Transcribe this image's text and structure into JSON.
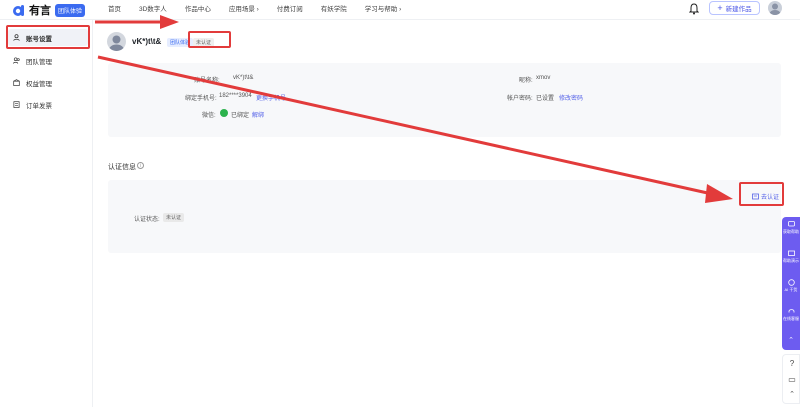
{
  "header": {
    "logo_text": "有言",
    "team_badge": "团队体验",
    "nav": [
      "首页",
      "3D数字人",
      "作品中心",
      "应用场景 ›",
      "付费订阅",
      "有妖学院",
      "学习与帮助 ›"
    ],
    "new_button": "新建作品"
  },
  "sidebar": {
    "items": [
      {
        "label": "账号设置",
        "icon": "user-icon",
        "active": true
      },
      {
        "label": "团队管理",
        "icon": "team-icon",
        "active": false
      },
      {
        "label": "权益管理",
        "icon": "benefit-icon",
        "active": false
      },
      {
        "label": "订单发票",
        "icon": "order-icon",
        "active": false
      }
    ]
  },
  "profile": {
    "name": "vK*)t\\t&",
    "team_tag": "团队体验",
    "verify_tag": "未认证"
  },
  "info": {
    "account_label": "账号名称:",
    "account_value": "vK*)t\\t&",
    "nickname_label": "昵称:",
    "nickname_value": "xmov",
    "phone_label": "绑定手机号:",
    "phone_value": "182****3904",
    "phone_link": "更换手机号",
    "password_label": "帐户密码:",
    "password_value": "已设置",
    "password_link": "修改密码",
    "wechat_label": "微信:",
    "wechat_value": "已绑定",
    "wechat_link": "解绑"
  },
  "verification": {
    "section_title": "认证信息",
    "status_label": "认证状态:",
    "status_value": "未认证",
    "go_verify": "去认证"
  },
  "float_panel": {
    "items": [
      "获取帮助",
      "帮助演示",
      "AI 干货",
      "在线客服"
    ]
  },
  "colors": {
    "accent": "#5562e8",
    "annotation_red": "#e23b3b",
    "float_panel": "#6d5cf0"
  }
}
